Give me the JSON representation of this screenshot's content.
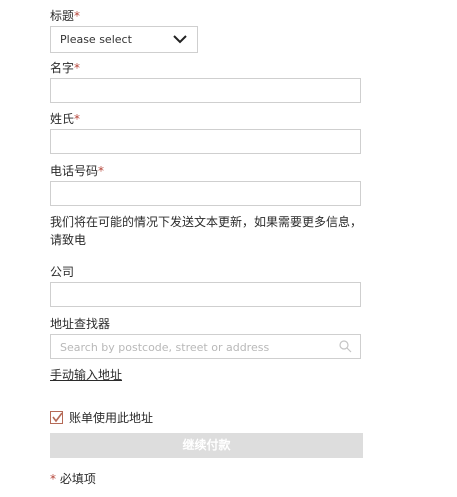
{
  "form": {
    "title_label": "标题",
    "title_select": {
      "value": "Please select"
    },
    "first_name_label": "名字",
    "last_name_label": "姓氏",
    "phone_label": "电话号码",
    "required_mark": "*",
    "sms_info": "我们将在可能的情况下发送文本更新，如果需要更多信息，请致电",
    "company_label": "公司",
    "address_finder_label": "地址查找器",
    "address_search_placeholder": "Search by postcode, street or address",
    "manual_address_link": "手动输入地址",
    "billing_checkbox_label": "账单使用此地址",
    "billing_checked": true,
    "continue_button": "继续付款",
    "required_note": "必填项"
  },
  "colors": {
    "required": "#b5453a",
    "checkbox": "#b56a57",
    "button_bg": "#dddddd"
  }
}
